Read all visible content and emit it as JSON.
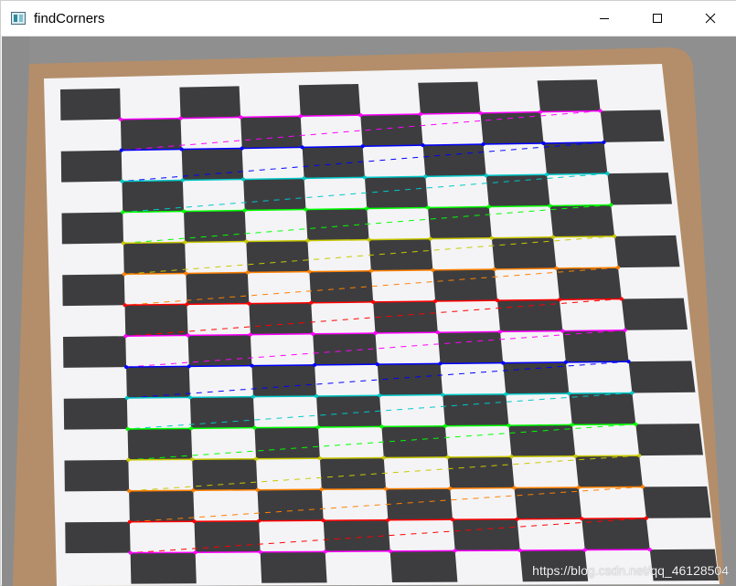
{
  "window": {
    "title": "findCorners",
    "minimize_icon": "minimize-icon",
    "maximize_icon": "maximize-icon",
    "close_icon": "close-icon"
  },
  "image": {
    "description_icon": "chessboard-image",
    "row_colors": [
      "#ff00ff",
      "#0000ff",
      "#00c8c8",
      "#00ff00",
      "#c8c800",
      "#ff8000",
      "#ff0000"
    ]
  },
  "watermark": {
    "text": "https://blog.csdn.net/qq_46128504"
  }
}
